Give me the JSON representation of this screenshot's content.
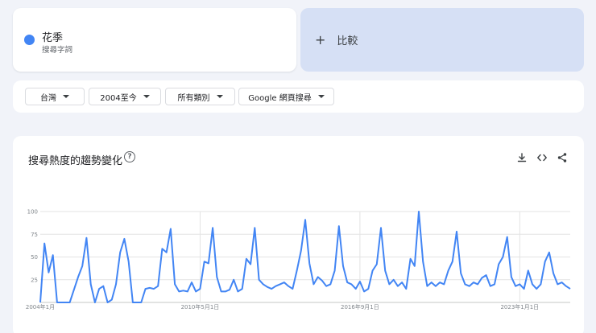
{
  "term": {
    "name": "花季",
    "type": "搜尋字詞",
    "color": "#4285f4"
  },
  "compare": {
    "plus": "+",
    "label": "比較"
  },
  "filters": {
    "region": "台灣",
    "time": "2004至今",
    "category": "所有類別",
    "search_type": "Google 網頁搜尋"
  },
  "chart_header": {
    "title": "搜尋熱度的趨勢變化",
    "help_symbol": "?",
    "icons": [
      "download-icon",
      "embed-icon",
      "share-icon"
    ]
  },
  "chart_data": {
    "type": "line",
    "title": "",
    "xlabel": "",
    "ylabel": "",
    "ylim": [
      0,
      100
    ],
    "y_ticks": [
      "25",
      "50",
      "75",
      "100"
    ],
    "x_tick_labels": [
      "2004年1月",
      "2010年5月1日",
      "2016年9月1日",
      "2023年1月1日"
    ],
    "x_tick_months": [
      0,
      76,
      152,
      228
    ],
    "line_color": "#4285f4",
    "grid": true,
    "total_months": 252,
    "series": [
      {
        "name": "花季",
        "values": [
          [
            0,
            0
          ],
          [
            2,
            65
          ],
          [
            4,
            33
          ],
          [
            6,
            52
          ],
          [
            8,
            0
          ],
          [
            14,
            0
          ],
          [
            18,
            28
          ],
          [
            20,
            40
          ],
          [
            22,
            71
          ],
          [
            24,
            20
          ],
          [
            26,
            0
          ],
          [
            28,
            15
          ],
          [
            30,
            18
          ],
          [
            32,
            0
          ],
          [
            34,
            3
          ],
          [
            36,
            20
          ],
          [
            38,
            55
          ],
          [
            40,
            70
          ],
          [
            42,
            45
          ],
          [
            44,
            0
          ],
          [
            48,
            0
          ],
          [
            50,
            15
          ],
          [
            52,
            16
          ],
          [
            54,
            15
          ],
          [
            56,
            18
          ],
          [
            58,
            59
          ],
          [
            60,
            55
          ],
          [
            62,
            81
          ],
          [
            64,
            20
          ],
          [
            66,
            12
          ],
          [
            68,
            13
          ],
          [
            70,
            12
          ],
          [
            72,
            22
          ],
          [
            74,
            12
          ],
          [
            76,
            15
          ],
          [
            78,
            45
          ],
          [
            80,
            43
          ],
          [
            82,
            82
          ],
          [
            84,
            28
          ],
          [
            86,
            12
          ],
          [
            88,
            12
          ],
          [
            90,
            14
          ],
          [
            92,
            25
          ],
          [
            94,
            12
          ],
          [
            96,
            15
          ],
          [
            98,
            48
          ],
          [
            100,
            42
          ],
          [
            102,
            82
          ],
          [
            104,
            25
          ],
          [
            106,
            20
          ],
          [
            108,
            17
          ],
          [
            110,
            15
          ],
          [
            112,
            18
          ],
          [
            114,
            20
          ],
          [
            116,
            22
          ],
          [
            118,
            18
          ],
          [
            120,
            15
          ],
          [
            122,
            35
          ],
          [
            124,
            57
          ],
          [
            126,
            91
          ],
          [
            128,
            43
          ],
          [
            130,
            20
          ],
          [
            132,
            28
          ],
          [
            134,
            24
          ],
          [
            136,
            18
          ],
          [
            138,
            20
          ],
          [
            140,
            35
          ],
          [
            142,
            84
          ],
          [
            144,
            40
          ],
          [
            146,
            22
          ],
          [
            148,
            20
          ],
          [
            150,
            15
          ],
          [
            152,
            23
          ],
          [
            154,
            12
          ],
          [
            156,
            15
          ],
          [
            158,
            35
          ],
          [
            160,
            42
          ],
          [
            162,
            82
          ],
          [
            164,
            35
          ],
          [
            166,
            20
          ],
          [
            168,
            25
          ],
          [
            170,
            18
          ],
          [
            172,
            22
          ],
          [
            174,
            15
          ],
          [
            176,
            48
          ],
          [
            178,
            40
          ],
          [
            180,
            100
          ],
          [
            182,
            45
          ],
          [
            184,
            18
          ],
          [
            186,
            22
          ],
          [
            188,
            18
          ],
          [
            190,
            22
          ],
          [
            192,
            20
          ],
          [
            194,
            35
          ],
          [
            196,
            45
          ],
          [
            198,
            78
          ],
          [
            200,
            32
          ],
          [
            202,
            20
          ],
          [
            204,
            18
          ],
          [
            206,
            22
          ],
          [
            208,
            20
          ],
          [
            210,
            27
          ],
          [
            212,
            30
          ],
          [
            214,
            18
          ],
          [
            216,
            20
          ],
          [
            218,
            42
          ],
          [
            220,
            50
          ],
          [
            222,
            72
          ],
          [
            224,
            28
          ],
          [
            226,
            18
          ],
          [
            228,
            20
          ],
          [
            230,
            15
          ],
          [
            232,
            35
          ],
          [
            234,
            20
          ],
          [
            236,
            15
          ],
          [
            238,
            20
          ],
          [
            240,
            45
          ],
          [
            242,
            55
          ],
          [
            244,
            32
          ],
          [
            246,
            20
          ],
          [
            248,
            22
          ],
          [
            250,
            18
          ],
          [
            252,
            15
          ]
        ]
      }
    ]
  }
}
